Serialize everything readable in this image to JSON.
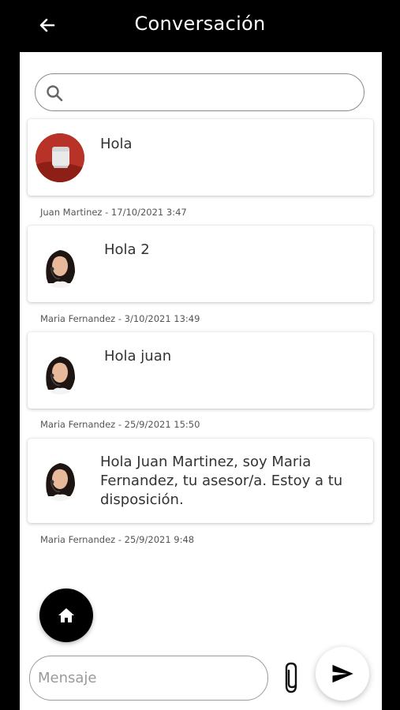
{
  "header": {
    "title": "Conversación",
    "back_icon": "arrow-left-icon"
  },
  "search": {
    "placeholder": "",
    "icon": "search-icon"
  },
  "messages": [
    {
      "text": "Hola",
      "meta": "Juan Martinez - 17/10/2021 3:47",
      "avatar": "speaker-photo-avatar"
    },
    {
      "text": "Hola 2",
      "meta": "Maria Fernandez - 3/10/2021 13:49",
      "avatar": "agent-avatar"
    },
    {
      "text": "Hola juan",
      "meta": "Maria Fernandez - 25/9/2021 15:50",
      "avatar": "agent-avatar"
    },
    {
      "text": "Hola Juan Martinez, soy Maria Fernandez, tu asesor/a. Estoy a tu disposición.",
      "meta": "Maria Fernandez - 25/9/2021 9:48",
      "avatar": "agent-avatar"
    }
  ],
  "composer": {
    "placeholder": "Mensaje",
    "attach_icon": "paperclip-icon",
    "send_icon": "send-icon"
  },
  "fab": {
    "home_icon": "home-icon"
  },
  "colors": {
    "header_bg": "#000000",
    "card_bg": "#ffffff",
    "speaker_avatar": "#c0392b"
  }
}
